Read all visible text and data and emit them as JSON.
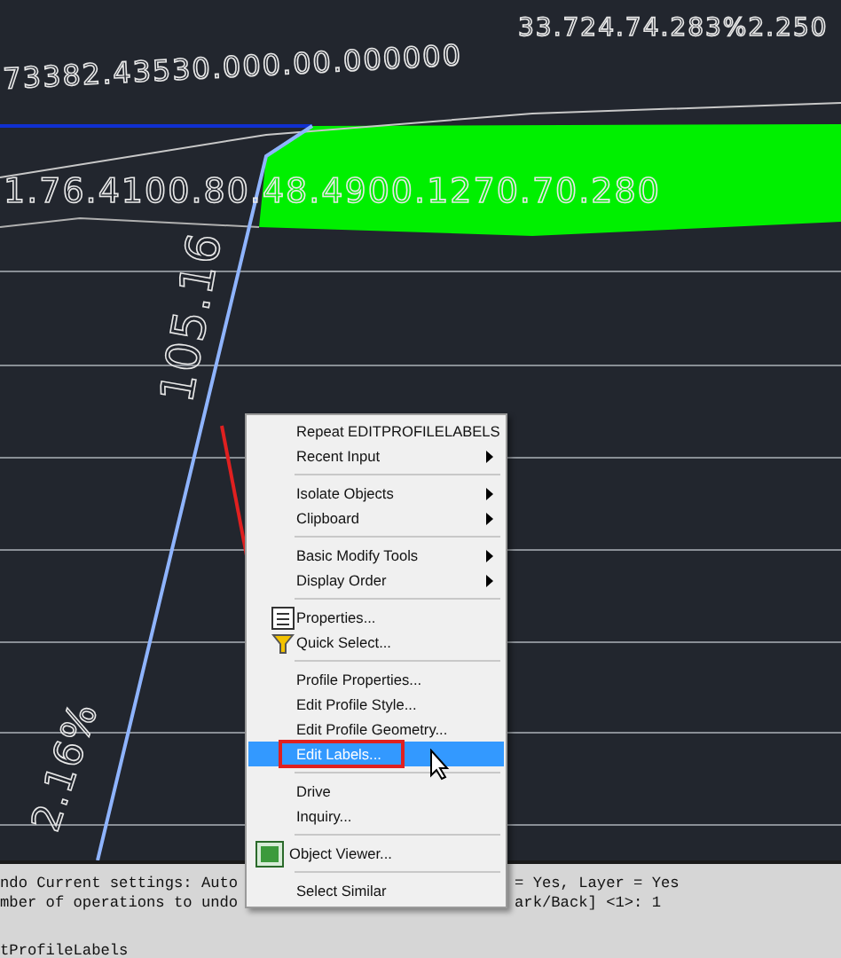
{
  "drawing": {
    "labels": [
      {
        "text": "33.724.74.283%2.250"
      },
      {
        "text": "73382.43530.000.00.000000"
      },
      {
        "text": "1.76.4100.80.48.4900.1270.70.280"
      },
      {
        "text": "105.16"
      },
      {
        "text": "2.16%"
      }
    ]
  },
  "context_menu": {
    "items": [
      {
        "kind": "plain",
        "label": "Repeat EDITPROFILELABELS",
        "selected": false
      },
      {
        "kind": "submenu",
        "label": "Recent Input",
        "selected": false
      },
      {
        "kind": "separator"
      },
      {
        "kind": "submenu",
        "label": "Isolate Objects",
        "selected": false
      },
      {
        "kind": "submenu",
        "label": "Clipboard",
        "selected": false
      },
      {
        "kind": "separator"
      },
      {
        "kind": "submenu",
        "label": "Basic Modify Tools",
        "selected": false
      },
      {
        "kind": "submenu",
        "label": "Display Order",
        "selected": false
      },
      {
        "kind": "separator"
      },
      {
        "kind": "sheet",
        "label": "Properties...",
        "selected": false
      },
      {
        "kind": "filter",
        "label": "Quick Select...",
        "selected": false
      },
      {
        "kind": "separator"
      },
      {
        "kind": "plain",
        "label": "Profile Properties...",
        "selected": false
      },
      {
        "kind": "plain",
        "label": "Edit Profile Style...",
        "selected": false
      },
      {
        "kind": "plain",
        "label": "Edit Profile Geometry...",
        "selected": false
      },
      {
        "kind": "plain",
        "label": "Edit Labels...",
        "selected": true
      },
      {
        "kind": "separator"
      },
      {
        "kind": "plain",
        "label": "Drive",
        "selected": false
      },
      {
        "kind": "plain",
        "label": "Inquiry...",
        "selected": false
      },
      {
        "kind": "separator"
      },
      {
        "kind": "viewer",
        "label": "Object Viewer...",
        "selected": false
      },
      {
        "kind": "separator"
      },
      {
        "kind": "plain",
        "label": "Select Similar",
        "selected": false
      }
    ]
  },
  "command_line": {
    "lines": [
      {
        "left": "ndo Current settings: Auto",
        "right": "= Yes, Layer = Yes"
      },
      {
        "left": "mber of operations to undo",
        "right": "ark/Back] <1>: 1"
      }
    ],
    "prompt": "tProfileLabels"
  }
}
